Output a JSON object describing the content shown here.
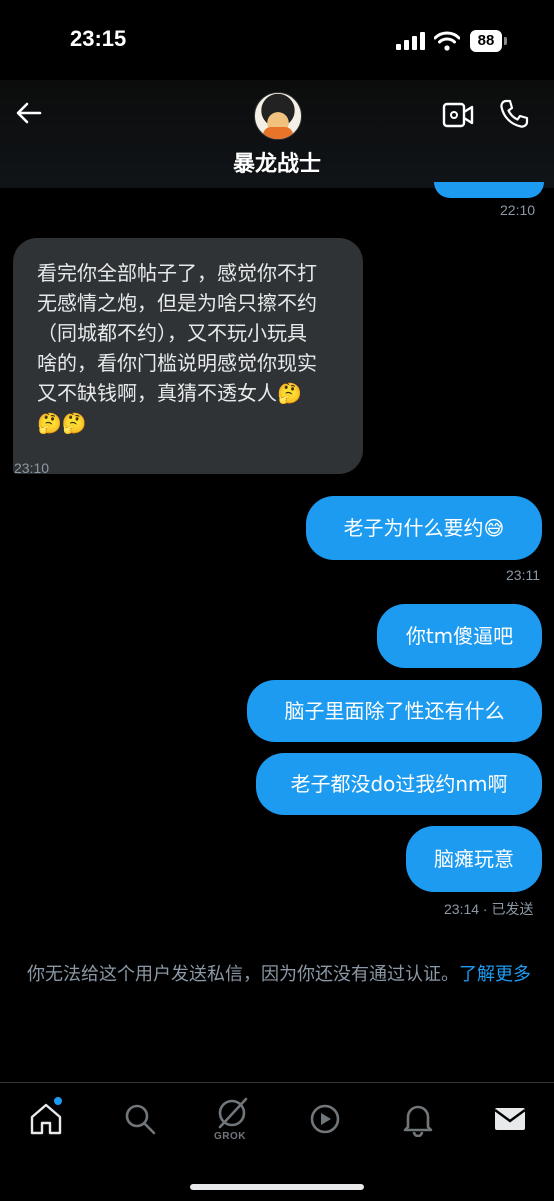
{
  "status": {
    "time": "23:15",
    "battery": "88"
  },
  "header": {
    "name": "暴龙战士"
  },
  "messages": [
    {
      "dir": "out",
      "time": "22:10"
    },
    {
      "dir": "in",
      "lines": [
        "看完你全部帖子了，感觉你不打",
        "无感情之炮，但是为啥只擦不约",
        "（同城都不约），又不玩小玩具",
        "啥的，看你门槛说明感觉你现实",
        "又不缺钱啊，真猜不透女人🤔",
        "🤔🤔"
      ],
      "time": "23:10"
    },
    {
      "dir": "out",
      "text": "老子为什么要约😅",
      "time": "23:11"
    },
    {
      "dir": "out",
      "text": "你tm傻逼吧"
    },
    {
      "dir": "out",
      "text": "脑子里面除了性还有什么"
    },
    {
      "dir": "out",
      "text": "老子都没do过我约nm啊"
    },
    {
      "dir": "out",
      "text": "脑瘫玩意",
      "time": "23:14 · 已发送"
    }
  ],
  "notice": {
    "text": "你无法给这个用户发送私信，因为你还没有通过认证。",
    "link": "了解更多"
  },
  "tabs": {
    "grok_label": "GROK"
  },
  "colors": {
    "accent": "#1d9bf0",
    "incoming_bubble": "#2f3336"
  },
  "icons": [
    "back-arrow-icon",
    "video-icon",
    "phone-icon",
    "home-icon",
    "search-icon",
    "grok-icon",
    "play-icon",
    "bell-icon",
    "mail-icon"
  ]
}
